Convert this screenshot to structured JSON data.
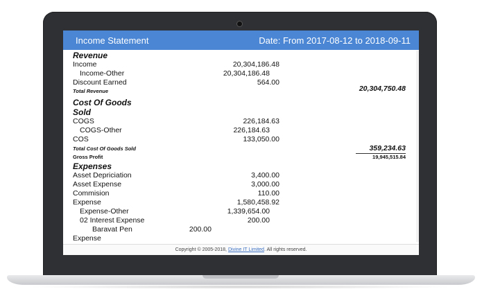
{
  "header": {
    "title": "Income Statement",
    "date_range": "Date: From 2017-08-12 to 2018-09-11"
  },
  "report": {
    "revenue_heading": "Revenue",
    "income_label": "Income",
    "income_value": "20,304,186.48",
    "income_other_label": "Income-Other",
    "income_other_value": "20,304,186.48",
    "discount_label": "Discount Earned",
    "discount_value": "564.00",
    "total_revenue_label": "Total Revenue",
    "total_revenue_value": "20,304,750.48",
    "cogs_heading_1": "Cost Of Goods",
    "cogs_heading_2": "Sold",
    "cogs_label": "COGS",
    "cogs_value": "226,184.63",
    "cogs_other_label": "COGS-Other",
    "cogs_other_value": "226,184.63",
    "cos_label": "COS",
    "cos_value": "133,050.00",
    "total_cogs_label": "Total Cost Of Goods Sold",
    "total_cogs_value": "359,234.63",
    "gross_profit_label": "Gross Profit",
    "gross_profit_value": "19,945,515.84",
    "expenses_heading": "Expenses",
    "asset_dep_label": "Asset Depriciation",
    "asset_dep_value": "3,400.00",
    "asset_exp_label": "Asset Expense",
    "asset_exp_value": "3,000.00",
    "commision_label": "Commision",
    "commision_value": "110.00",
    "expense_label": "Expense",
    "expense_value": "1,580,458.92",
    "expense_other_label": "Expense-Other",
    "expense_other_value": "1,339,654.00",
    "interest_label": "02 Interest Expense",
    "interest_value": "200.00",
    "baravat_label": "Baravat Pen",
    "baravat_value": "200.00",
    "expense_cut_label": "Expense"
  },
  "footer": {
    "prefix": "Copyright © 2005-2018,",
    "link": "Divine IT Limited",
    "suffix": ". All rights reserved."
  }
}
